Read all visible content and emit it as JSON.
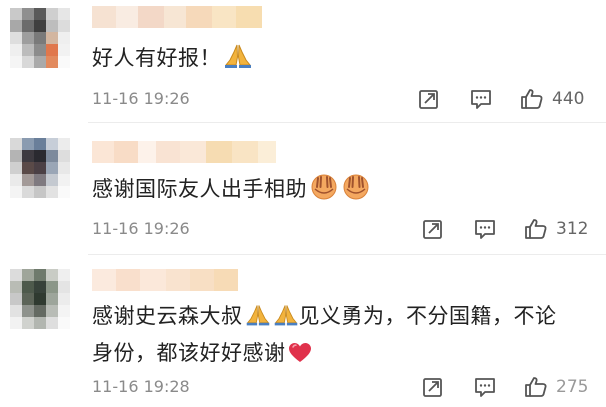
{
  "comments": [
    {
      "text": "好人有好报！",
      "emoji": "folded-hands-icon",
      "time": "11-16 19:26",
      "likes": "440"
    },
    {
      "text": "感谢国际友人出手相助",
      "emoji": "hands-icon",
      "time": "11-16 19:26",
      "likes": "312"
    },
    {
      "text_line1_a": "感谢史云森大叔",
      "text_line1_b": "见义勇为，不分国籍，不论",
      "text_line2": "身份，都该好好感谢",
      "emoji": "heart-icon",
      "time": "11-16 19:28",
      "likes": "275"
    }
  ],
  "icons": {
    "share": "share-icon",
    "comment": "comment-icon",
    "like": "thumbs-up-icon"
  },
  "colors": {
    "text": "#222222",
    "meta": "#8a8a8a",
    "icon": "#555555",
    "heart": "#e0314b"
  }
}
